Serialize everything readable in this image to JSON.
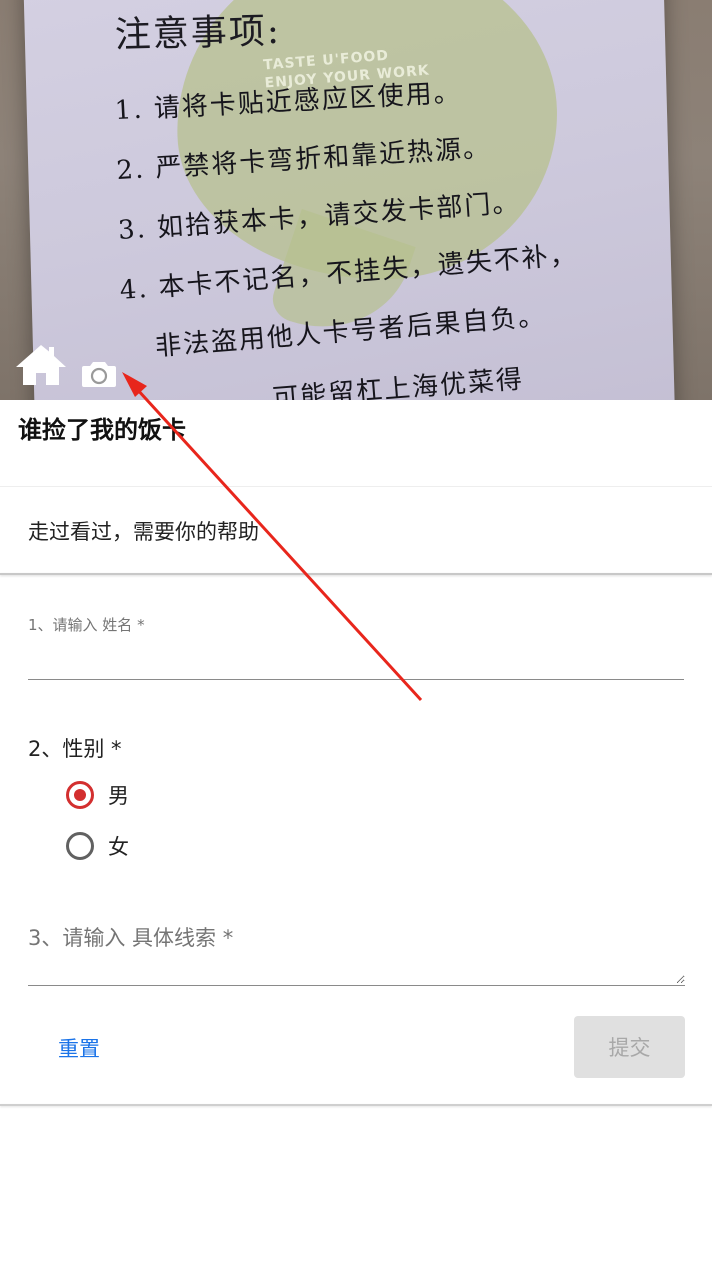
{
  "header": {
    "card_title": "注意事项:",
    "card_brand_line1": "TASTE U'FOOD",
    "card_brand_line2": "ENJOY YOUR WORK",
    "card_lines": [
      "1. 请将卡贴近感应区使用。",
      "2. 严禁将卡弯折和靠近热源。",
      "3. 如拾获本卡，请交发卡部门。",
      "4. 本卡不记名，不挂失，遗失不补，",
      "非法盗用他人卡号者后果自负。",
      "可能留杠上海优菜得"
    ],
    "home_icon": "home-icon",
    "camera_icon": "camera-icon"
  },
  "form": {
    "title": "谁捡了我的饭卡",
    "description": "走过看过，需要你的帮助",
    "q1": {
      "label": "1、请输入 姓名 *",
      "value": ""
    },
    "q2": {
      "label": "2、性别 *",
      "options": [
        {
          "label": "男",
          "checked": true
        },
        {
          "label": "女",
          "checked": false
        }
      ]
    },
    "q3": {
      "placeholder": "3、请输入 具体线索 *",
      "value": ""
    },
    "reset_label": "重置",
    "submit_label": "提交"
  },
  "colors": {
    "accent_red": "#d32f2f",
    "link_blue": "#1a73e8",
    "annotation_arrow": "#e8261c"
  }
}
